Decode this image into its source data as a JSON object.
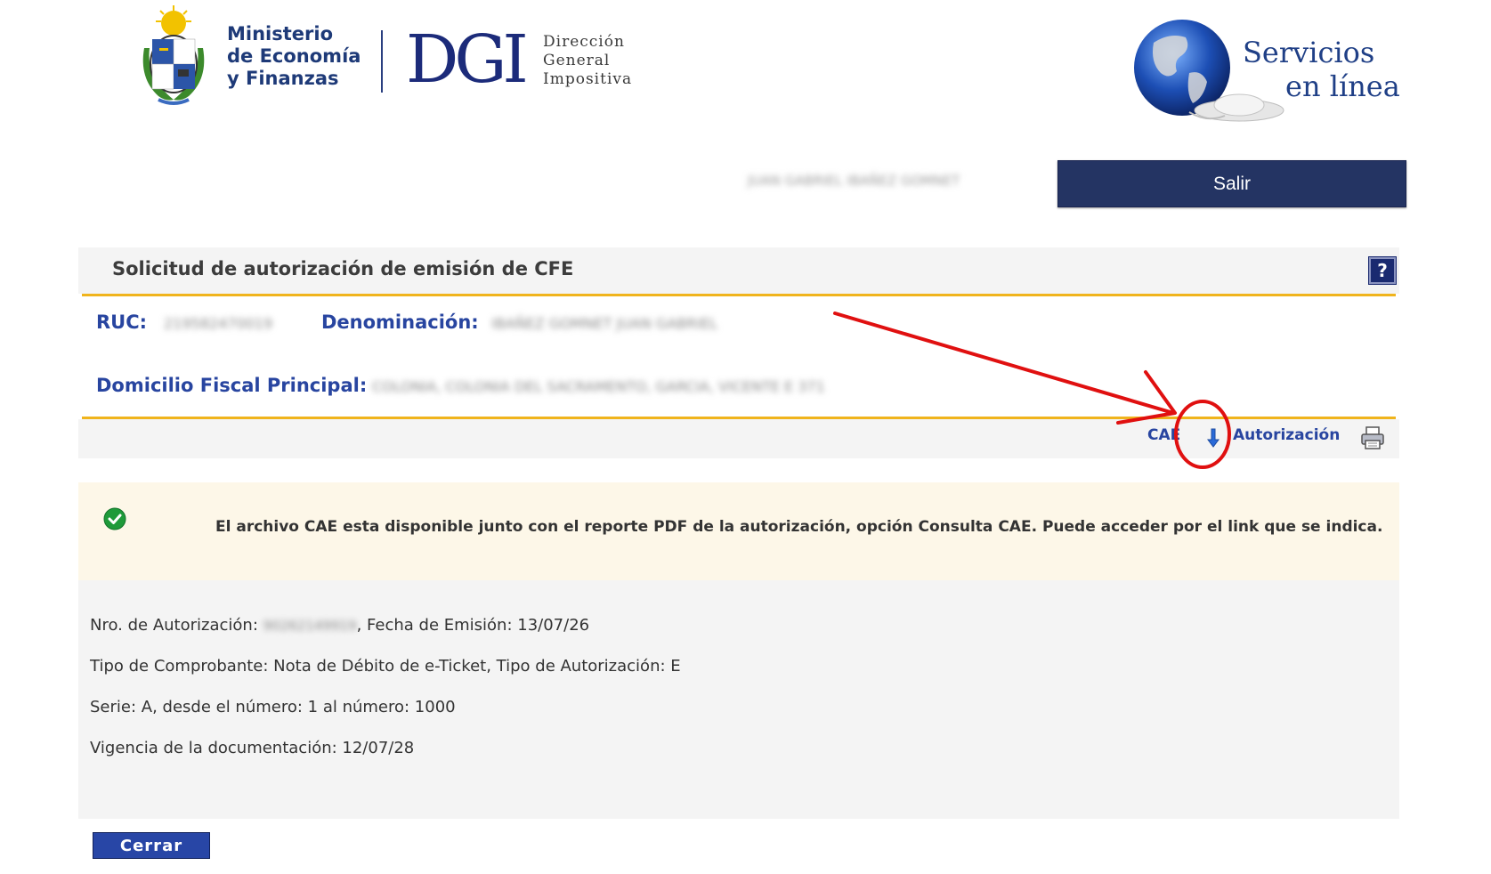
{
  "header": {
    "ministry_lines": [
      "Ministerio",
      "de Economía",
      "y Finanzas"
    ],
    "dgi_logo": "DGI",
    "dgi_sub_lines": [
      "Dirección",
      "General",
      "Impositiva"
    ],
    "servicios_lines": [
      "Servicios",
      "en línea"
    ],
    "user_name": "JUAN GABRIEL IBAÑEZ GOMNET",
    "logout_label": "Salir"
  },
  "panel": {
    "title": "Solicitud de autorización de emisión de CFE",
    "help_label": "?",
    "ruc_label": "RUC:",
    "ruc_value": "219582470019",
    "denominacion_label": "Denominación:",
    "denominacion_value": "IBAÑEZ GOMNET JUAN GABRIEL",
    "domicilio_label": "Domicilio Fiscal Principal:",
    "domicilio_value": "COLONIA, COLONIA DEL SACRAMENTO, GARCIA, VICENTE E 371"
  },
  "toolbar": {
    "cae_label": "CAE",
    "autorizacion_label": "Autorización"
  },
  "message": {
    "text": "El archivo CAE esta disponible junto con el reporte PDF de la autorización, opción Consulta CAE. Puede acceder por el link que se indica."
  },
  "details": {
    "nro_label": "Nro. de Autorización: ",
    "nro_value": "90262149919",
    "fecha_label": ", Fecha de Emisión: 13/07/26",
    "tipo_line": "Tipo de Comprobante: Nota de Débito de e-Ticket, Tipo de Autorización: E",
    "serie_line": "Serie: A, desde el número: 1 al número: 1000",
    "vigencia_line": "Vigencia de la documentación: 12/07/28"
  },
  "footer": {
    "close_label": "Cerrar"
  },
  "colors": {
    "brand_navy": "#243463",
    "link_blue": "#2845a0",
    "gold_rule": "#f0b41c",
    "annotation_red": "#e01010"
  }
}
